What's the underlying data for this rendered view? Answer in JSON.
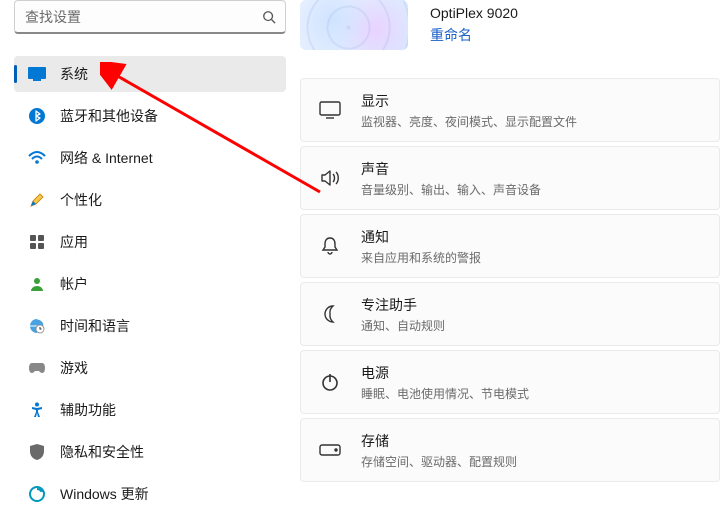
{
  "search": {
    "placeholder": "查找设置"
  },
  "nav": [
    {
      "key": "system",
      "label": "系统"
    },
    {
      "key": "bluetooth",
      "label": "蓝牙和其他设备"
    },
    {
      "key": "network",
      "label": "网络 & Internet"
    },
    {
      "key": "personalize",
      "label": "个性化"
    },
    {
      "key": "apps",
      "label": "应用"
    },
    {
      "key": "accounts",
      "label": "帐户"
    },
    {
      "key": "time",
      "label": "时间和语言"
    },
    {
      "key": "gaming",
      "label": "游戏"
    },
    {
      "key": "accessibility",
      "label": "辅助功能"
    },
    {
      "key": "privacy",
      "label": "隐私和安全性"
    },
    {
      "key": "update",
      "label": "Windows 更新"
    }
  ],
  "active_nav_index": 0,
  "device": {
    "model": "OptiPlex 9020",
    "rename_label": "重命名"
  },
  "cards": [
    {
      "key": "display",
      "title": "显示",
      "sub": "监视器、亮度、夜间模式、显示配置文件"
    },
    {
      "key": "sound",
      "title": "声音",
      "sub": "音量级别、输出、输入、声音设备"
    },
    {
      "key": "notif",
      "title": "通知",
      "sub": "来自应用和系统的警报"
    },
    {
      "key": "focus",
      "title": "专注助手",
      "sub": "通知、自动规则"
    },
    {
      "key": "power",
      "title": "电源",
      "sub": "睡眠、电池使用情况、节电模式"
    },
    {
      "key": "storage",
      "title": "存储",
      "sub": "存储空间、驱动器、配置规则"
    }
  ],
  "colors": {
    "accent": "#005fb8",
    "arrow": "#ff0000"
  }
}
